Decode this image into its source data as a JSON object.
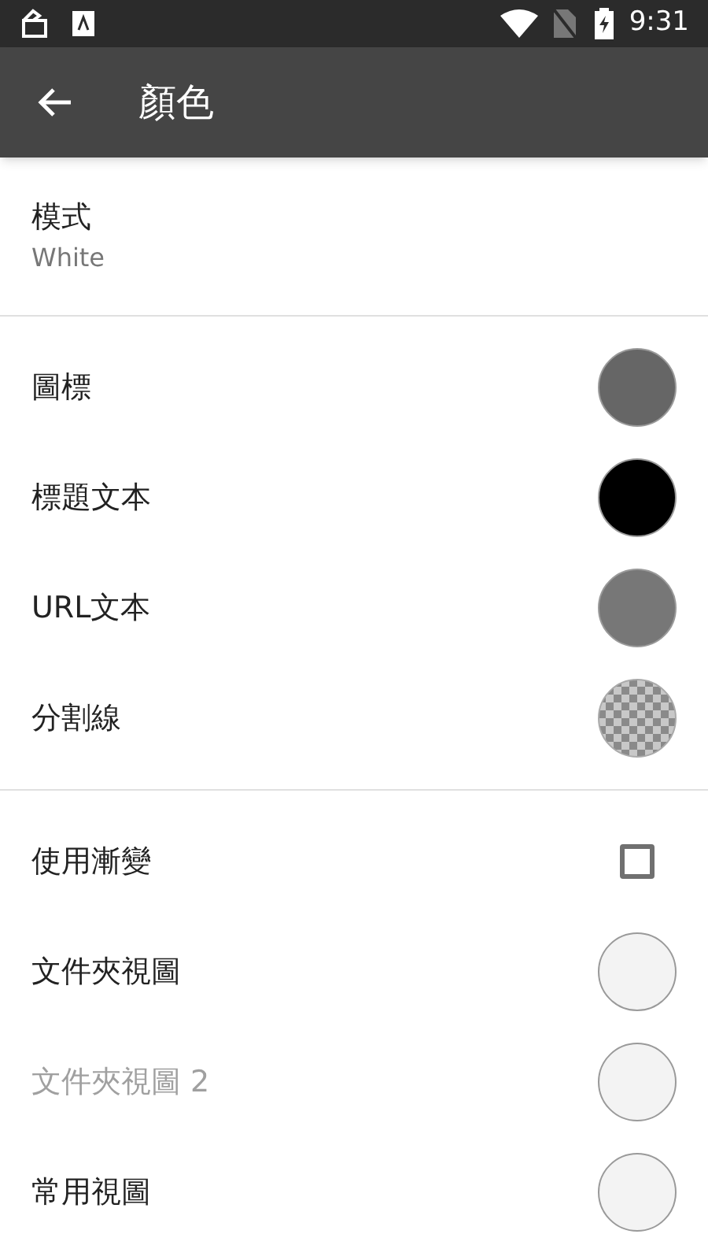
{
  "status_bar": {
    "time": "9:31"
  },
  "app_bar": {
    "title": "顏色"
  },
  "mode": {
    "label": "模式",
    "value": "White"
  },
  "sections": [
    {
      "items": [
        {
          "kind": "swatch",
          "label": "圖標",
          "color": "#666666",
          "disabled": false
        },
        {
          "kind": "swatch",
          "label": "標題文本",
          "color": "#000000",
          "disabled": false
        },
        {
          "kind": "swatch",
          "label": "URL文本",
          "color": "#777777",
          "disabled": false
        },
        {
          "kind": "transparent",
          "label": "分割線",
          "disabled": false
        }
      ]
    },
    {
      "items": [
        {
          "kind": "checkbox",
          "label": "使用漸變",
          "checked": false,
          "disabled": false
        },
        {
          "kind": "swatch",
          "label": "文件夾視圖",
          "color": "#f3f3f3",
          "disabled": false
        },
        {
          "kind": "swatch",
          "label": "文件夾視圖 2",
          "color": "#f3f3f3",
          "disabled": true
        },
        {
          "kind": "swatch",
          "label": "常用視圖",
          "color": "#f3f3f3",
          "disabled": false
        }
      ]
    }
  ]
}
